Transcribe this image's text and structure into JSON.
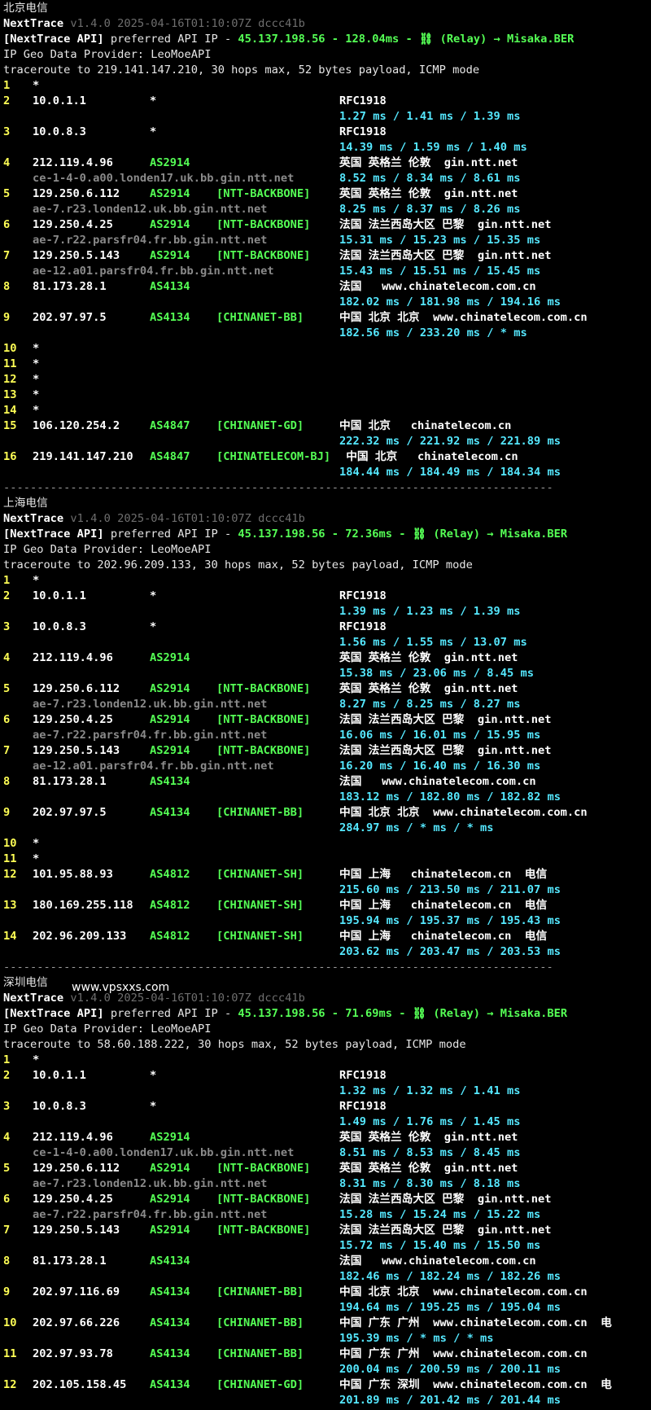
{
  "watermark": "www.vpsxxs.com",
  "sections": [
    {
      "name": "北京电信",
      "header": {
        "tool": "NextTrace",
        "version": "v1.4.0 2025-04-16T01:10:07Z dccc41b",
        "api_prefix": "[NextTrace API]",
        "api_text": " preferred API IP - ",
        "api_ip": "45.137.198.56",
        "api_sep": " - ",
        "api_latency": "128.04ms",
        "api_relay": " - ⛓ (Relay) → Misaka.BER",
        "geo_provider": "IP Geo Data Provider: LeoMoeAPI",
        "trace_line": "traceroute to 219.141.147.210, 30 hops max, 52 bytes payload, ICMP mode"
      },
      "hops": [
        {
          "hop": "1",
          "ip": "*"
        },
        {
          "hop": "2",
          "ip": "10.0.1.1",
          "as": "*",
          "geo": "RFC1918",
          "rtt": "1.27 ms / 1.41 ms / 1.39 ms"
        },
        {
          "hop": "3",
          "ip": "10.0.8.3",
          "as": "*",
          "geo": "RFC1918",
          "rtt": "14.39 ms / 1.59 ms / 1.40 ms"
        },
        {
          "hop": "4",
          "ip": "212.119.4.96",
          "as": "AS2914",
          "geo": "英国 英格兰 伦敦  gin.ntt.net",
          "host": "ce-1-4-0.a00.londen17.uk.bb.gin.ntt.net",
          "rtt": "8.52 ms / 8.34 ms / 8.61 ms"
        },
        {
          "hop": "5",
          "ip": "129.250.6.112",
          "as": "AS2914",
          "tag": "[NTT-BACKBONE]",
          "geo": "英国 英格兰 伦敦  gin.ntt.net",
          "host": "ae-7.r23.londen12.uk.bb.gin.ntt.net",
          "rtt": "8.25 ms / 8.37 ms / 8.26 ms"
        },
        {
          "hop": "6",
          "ip": "129.250.4.25",
          "as": "AS2914",
          "tag": "[NTT-BACKBONE]",
          "geo": "法国 法兰西岛大区 巴黎  gin.ntt.net",
          "host": "ae-7.r22.parsfr04.fr.bb.gin.ntt.net",
          "rtt": "15.31 ms / 15.23 ms / 15.35 ms"
        },
        {
          "hop": "7",
          "ip": "129.250.5.143",
          "as": "AS2914",
          "tag": "[NTT-BACKBONE]",
          "geo": "法国 法兰西岛大区 巴黎  gin.ntt.net",
          "host": "ae-12.a01.parsfr04.fr.bb.gin.ntt.net",
          "rtt": "15.43 ms / 15.51 ms / 15.45 ms"
        },
        {
          "hop": "8",
          "ip": "81.173.28.1",
          "as": "AS4134",
          "geo": "法国   www.chinatelecom.com.cn",
          "rtt": "182.02 ms / 181.98 ms / 194.16 ms"
        },
        {
          "hop": "9",
          "ip": "202.97.97.5",
          "as": "AS4134",
          "tag": "[CHINANET-BB]",
          "geo": "中国 北京 北京  www.chinatelecom.com.cn",
          "rtt": "182.56 ms / 233.20 ms / * ms"
        },
        {
          "hop": "10",
          "ip": "*"
        },
        {
          "hop": "11",
          "ip": "*"
        },
        {
          "hop": "12",
          "ip": "*"
        },
        {
          "hop": "13",
          "ip": "*"
        },
        {
          "hop": "14",
          "ip": "*"
        },
        {
          "hop": "15",
          "ip": "106.120.254.2",
          "as": "AS4847",
          "tag": "[CHINANET-GD]",
          "geo": "中国 北京   chinatelecom.cn",
          "rtt": "222.32 ms / 221.92 ms / 221.89 ms"
        },
        {
          "hop": "16",
          "ip": "219.141.147.210",
          "as": "AS4847",
          "tag": "[CHINATELECOM-BJ]",
          "geo": " 中国 北京   chinatelecom.cn",
          "rtt": "184.44 ms / 184.49 ms / 184.34 ms"
        }
      ],
      "separator": "----------------------------------------------------------------------------------"
    },
    {
      "name": "上海电信",
      "header": {
        "tool": "NextTrace",
        "version": "v1.4.0 2025-04-16T01:10:07Z dccc41b",
        "api_prefix": "[NextTrace API]",
        "api_text": " preferred API IP - ",
        "api_ip": "45.137.198.56",
        "api_sep": " - ",
        "api_latency": "72.36ms",
        "api_relay": " - ⛓ (Relay) → Misaka.BER",
        "geo_provider": "IP Geo Data Provider: LeoMoeAPI",
        "trace_line": "traceroute to 202.96.209.133, 30 hops max, 52 bytes payload, ICMP mode"
      },
      "hops": [
        {
          "hop": "1",
          "ip": "*"
        },
        {
          "hop": "2",
          "ip": "10.0.1.1",
          "as": "*",
          "geo": "RFC1918",
          "rtt": "1.39 ms / 1.23 ms / 1.39 ms"
        },
        {
          "hop": "3",
          "ip": "10.0.8.3",
          "as": "*",
          "geo": "RFC1918",
          "rtt": "1.56 ms / 1.55 ms / 13.07 ms"
        },
        {
          "hop": "4",
          "ip": "212.119.4.96",
          "as": "AS2914",
          "geo": "英国 英格兰 伦敦  gin.ntt.net",
          "rtt": "15.38 ms / 23.06 ms / 8.45 ms"
        },
        {
          "hop": "5",
          "ip": "129.250.6.112",
          "as": "AS2914",
          "tag": "[NTT-BACKBONE]",
          "geo": "英国 英格兰 伦敦  gin.ntt.net",
          "host": "ae-7.r23.londen12.uk.bb.gin.ntt.net",
          "rtt": "8.27 ms / 8.25 ms / 8.27 ms"
        },
        {
          "hop": "6",
          "ip": "129.250.4.25",
          "as": "AS2914",
          "tag": "[NTT-BACKBONE]",
          "geo": "法国 法兰西岛大区 巴黎  gin.ntt.net",
          "host": "ae-7.r22.parsfr04.fr.bb.gin.ntt.net",
          "rtt": "16.06 ms / 16.01 ms / 15.95 ms"
        },
        {
          "hop": "7",
          "ip": "129.250.5.143",
          "as": "AS2914",
          "tag": "[NTT-BACKBONE]",
          "geo": "法国 法兰西岛大区 巴黎  gin.ntt.net",
          "host": "ae-12.a01.parsfr04.fr.bb.gin.ntt.net",
          "rtt": "16.20 ms / 16.40 ms / 16.30 ms"
        },
        {
          "hop": "8",
          "ip": "81.173.28.1",
          "as": "AS4134",
          "geo": "法国   www.chinatelecom.com.cn",
          "rtt": "183.12 ms / 182.80 ms / 182.82 ms"
        },
        {
          "hop": "9",
          "ip": "202.97.97.5",
          "as": "AS4134",
          "tag": "[CHINANET-BB]",
          "geo": "中国 北京 北京  www.chinatelecom.com.cn",
          "rtt": "284.97 ms / * ms / * ms"
        },
        {
          "hop": "10",
          "ip": "*"
        },
        {
          "hop": "11",
          "ip": "*"
        },
        {
          "hop": "12",
          "ip": "101.95.88.93",
          "as": "AS4812",
          "tag": "[CHINANET-SH]",
          "geo": "中国 上海   chinatelecom.cn  电信",
          "rtt": "215.60 ms / 213.50 ms / 211.07 ms"
        },
        {
          "hop": "13",
          "ip": "180.169.255.118",
          "as": "AS4812",
          "tag": "[CHINANET-SH]",
          "geo": "中国 上海   chinatelecom.cn  电信",
          "rtt": "195.94 ms / 195.37 ms / 195.43 ms"
        },
        {
          "hop": "14",
          "ip": "202.96.209.133",
          "as": "AS4812",
          "tag": "[CHINANET-SH]",
          "geo": "中国 上海   chinatelecom.cn  电信",
          "rtt": "203.62 ms / 203.47 ms / 203.53 ms"
        }
      ],
      "separator": "----------------------------------------------------------------------------------"
    },
    {
      "name": "深圳电信",
      "header": {
        "tool": "NextTrace",
        "version": "v1.4.0 2025-04-16T01:10:07Z dccc41b",
        "api_prefix": "[NextTrace API]",
        "api_text": " preferred API IP - ",
        "api_ip": "45.137.198.56",
        "api_sep": " - ",
        "api_latency": "71.69ms",
        "api_relay": " - ⛓ (Relay) → Misaka.BER",
        "geo_provider": "IP Geo Data Provider: LeoMoeAPI",
        "trace_line": "traceroute to 58.60.188.222, 30 hops max, 52 bytes payload, ICMP mode"
      },
      "hops": [
        {
          "hop": "1",
          "ip": "*"
        },
        {
          "hop": "2",
          "ip": "10.0.1.1",
          "as": "*",
          "geo": "RFC1918",
          "rtt": "1.32 ms / 1.32 ms / 1.41 ms"
        },
        {
          "hop": "3",
          "ip": "10.0.8.3",
          "as": "*",
          "geo": "RFC1918",
          "rtt": "1.49 ms / 1.76 ms / 1.45 ms"
        },
        {
          "hop": "4",
          "ip": "212.119.4.96",
          "as": "AS2914",
          "geo": "英国 英格兰 伦敦  gin.ntt.net",
          "host": "ce-1-4-0.a00.londen17.uk.bb.gin.ntt.net",
          "rtt": "8.51 ms / 8.53 ms / 8.45 ms"
        },
        {
          "hop": "5",
          "ip": "129.250.6.112",
          "as": "AS2914",
          "tag": "[NTT-BACKBONE]",
          "geo": "英国 英格兰 伦敦  gin.ntt.net",
          "host": "ae-7.r23.londen12.uk.bb.gin.ntt.net",
          "rtt": "8.31 ms / 8.30 ms / 8.18 ms"
        },
        {
          "hop": "6",
          "ip": "129.250.4.25",
          "as": "AS2914",
          "tag": "[NTT-BACKBONE]",
          "geo": "法国 法兰西岛大区 巴黎  gin.ntt.net",
          "host": "ae-7.r22.parsfr04.fr.bb.gin.ntt.net",
          "rtt": "15.28 ms / 15.24 ms / 15.22 ms"
        },
        {
          "hop": "7",
          "ip": "129.250.5.143",
          "as": "AS2914",
          "tag": "[NTT-BACKBONE]",
          "geo": "法国 法兰西岛大区 巴黎  gin.ntt.net",
          "rtt": "15.72 ms / 15.40 ms / 15.50 ms"
        },
        {
          "hop": "8",
          "ip": "81.173.28.1",
          "as": "AS4134",
          "geo": "法国   www.chinatelecom.com.cn",
          "rtt": "182.46 ms / 182.24 ms / 182.26 ms"
        },
        {
          "hop": "9",
          "ip": "202.97.116.69",
          "as": "AS4134",
          "tag": "[CHINANET-BB]",
          "geo": "中国 北京 北京  www.chinatelecom.com.cn",
          "rtt": "194.64 ms / 195.25 ms / 195.04 ms"
        },
        {
          "hop": "10",
          "ip": "202.97.66.226",
          "as": "AS4134",
          "tag": "[CHINANET-BB]",
          "geo": "中国 广东 广州  www.chinatelecom.com.cn  电",
          "rtt": "195.39 ms / * ms / * ms"
        },
        {
          "hop": "11",
          "ip": "202.97.93.78",
          "as": "AS4134",
          "tag": "[CHINANET-BB]",
          "geo": "中国 广东 广州  www.chinatelecom.com.cn",
          "rtt": "200.04 ms / 200.59 ms / 200.11 ms"
        },
        {
          "hop": "12",
          "ip": "202.105.158.45",
          "as": "AS4134",
          "tag": "[CHINANET-GD]",
          "geo": "中国 广东 深圳  www.chinatelecom.com.cn  电",
          "rtt": "201.89 ms / 201.42 ms / 201.44 ms"
        }
      ]
    }
  ]
}
